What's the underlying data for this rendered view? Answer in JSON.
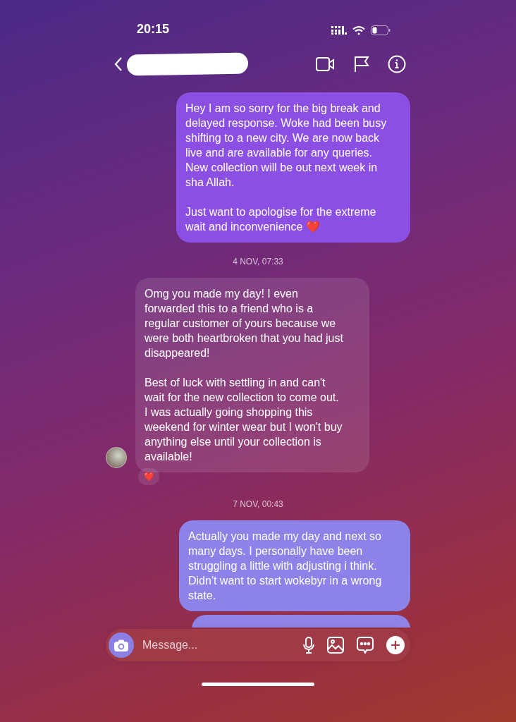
{
  "status_bar": {
    "time": "20:15"
  },
  "header": {
    "name_redacted": true
  },
  "messages": [
    {
      "kind": "sent",
      "paragraphs": [
        "Hey I am so sorry for the big break and delayed response. Woke had been busy shifting to a new city. We are now back live and are available for any queries. New collection will be out next week in sha Allah.",
        "Just want to apologise for the extreme wait and inconvenience ❤️"
      ]
    },
    {
      "kind": "timestamp",
      "text": "4 NOV, 07:33"
    },
    {
      "kind": "received",
      "paragraphs": [
        "Omg you made my day! I even forwarded this to a friend who is a regular customer of yours because we were both heartbroken that you had just disappeared!",
        "Best of luck with settling in and can't wait for the new collection to come out. I was actually going shopping this weekend for winter wear but I won't buy anything else until your collection is available!"
      ],
      "reaction": "❤️"
    },
    {
      "kind": "timestamp",
      "text": "7 NOV, 00:43"
    },
    {
      "kind": "sent",
      "paragraphs": [
        "Actually you made my day and next so many days. I personally have been struggling a little with adjusting i think. Didn't want to start wokebyr in a wrong state."
      ]
    },
    {
      "kind": "hidden"
    }
  ],
  "composer": {
    "placeholder": "Message..."
  }
}
